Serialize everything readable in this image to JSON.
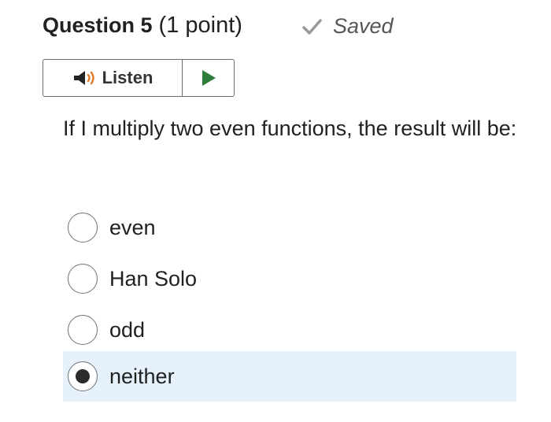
{
  "question": {
    "title": "Question 5",
    "points": "(1 point)",
    "status": "Saved",
    "text": "If I multiply two even functions, the result will be:"
  },
  "toolbar": {
    "listen_label": "Listen",
    "speaker_icon": "speaker-icon",
    "play_icon": "play-icon"
  },
  "options": [
    {
      "label": "even",
      "selected": false
    },
    {
      "label": "Han Solo",
      "selected": false
    },
    {
      "label": "odd",
      "selected": false
    },
    {
      "label": "neither",
      "selected": true
    }
  ],
  "colors": {
    "selected_bg": "#e6f1fb",
    "play_green": "#2e7d3a",
    "speaker_orange": "#e07b27",
    "checkmark": "#9a9a9a"
  }
}
